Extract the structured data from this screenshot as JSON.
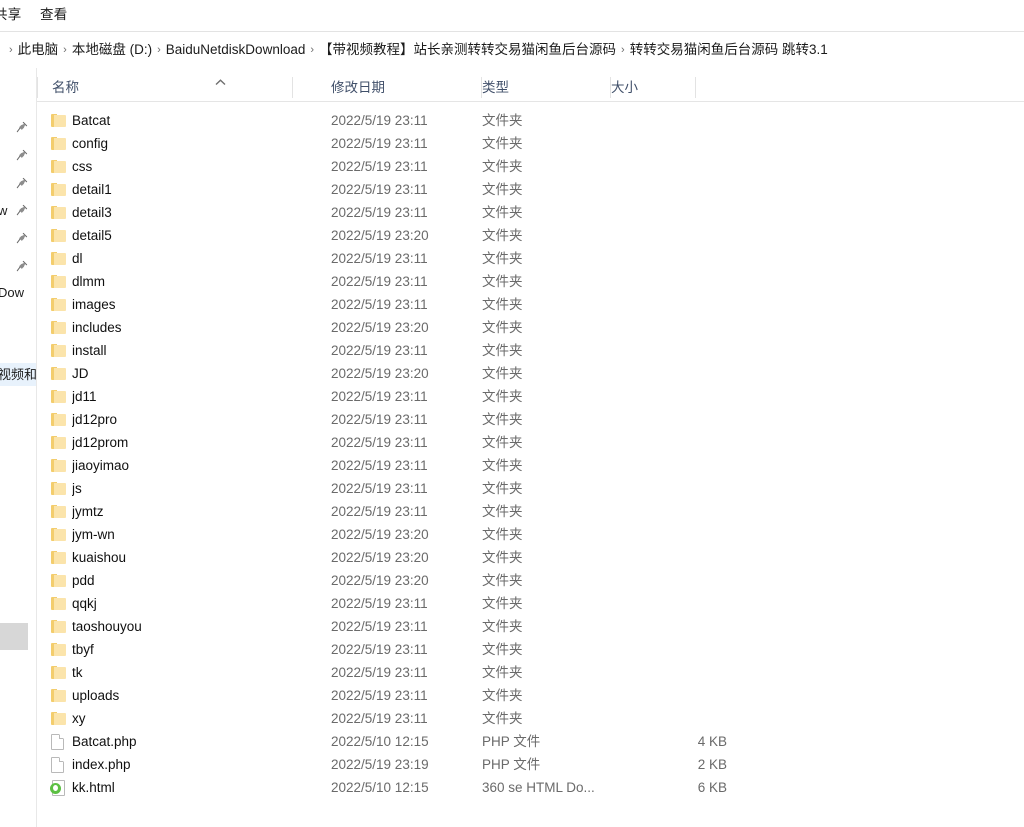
{
  "window": {
    "app": "windows-file-explorer"
  },
  "ribbon": {
    "tabs": [
      {
        "label": "共享",
        "name": "ribbon-tab-share"
      },
      {
        "label": "查看",
        "name": "ribbon-tab-view"
      }
    ]
  },
  "address_bar": {
    "separator": "›",
    "crumbs": [
      "此电脑",
      "本地磁盘 (D:)",
      "BaiduNetdiskDownload",
      "【带视频教程】站长亲测转转交易猫闲鱼后台源码",
      "转转交易猫闲鱼后台源码 跳转3.1"
    ]
  },
  "nav_pane": {
    "items": [
      {
        "label": "",
        "pinned": true,
        "highlight": false
      },
      {
        "label": "",
        "pinned": true,
        "highlight": false
      },
      {
        "label": "",
        "pinned": true,
        "highlight": false
      },
      {
        "label": "w",
        "pinned": true,
        "highlight": false
      },
      {
        "label": "",
        "pinned": true,
        "highlight": false
      },
      {
        "label": "",
        "pinned": true,
        "highlight": false
      },
      {
        "label": "Dow",
        "pinned": false,
        "highlight": false
      },
      {
        "label": "",
        "pinned": false,
        "highlight": false
      },
      {
        "label": "",
        "pinned": false,
        "highlight": false
      },
      {
        "label": "视频和",
        "pinned": false,
        "highlight": true
      }
    ]
  },
  "list_header": {
    "columns": [
      {
        "label": "名称",
        "key": "name"
      },
      {
        "label": "修改日期",
        "key": "date"
      },
      {
        "label": "类型",
        "key": "type"
      },
      {
        "label": "大小",
        "key": "size"
      }
    ],
    "sorted_by": "名称",
    "sort_direction": "ascending",
    "sort_icon": "chevron-up-icon"
  },
  "files": [
    {
      "name": "Batcat",
      "date": "2022/5/19 23:11",
      "type": "文件夹",
      "size": "",
      "icon": "folder"
    },
    {
      "name": "config",
      "date": "2022/5/19 23:11",
      "type": "文件夹",
      "size": "",
      "icon": "folder"
    },
    {
      "name": "css",
      "date": "2022/5/19 23:11",
      "type": "文件夹",
      "size": "",
      "icon": "folder"
    },
    {
      "name": "detail1",
      "date": "2022/5/19 23:11",
      "type": "文件夹",
      "size": "",
      "icon": "folder"
    },
    {
      "name": "detail3",
      "date": "2022/5/19 23:11",
      "type": "文件夹",
      "size": "",
      "icon": "folder"
    },
    {
      "name": "detail5",
      "date": "2022/5/19 23:20",
      "type": "文件夹",
      "size": "",
      "icon": "folder"
    },
    {
      "name": "dl",
      "date": "2022/5/19 23:11",
      "type": "文件夹",
      "size": "",
      "icon": "folder"
    },
    {
      "name": "dlmm",
      "date": "2022/5/19 23:11",
      "type": "文件夹",
      "size": "",
      "icon": "folder"
    },
    {
      "name": "images",
      "date": "2022/5/19 23:11",
      "type": "文件夹",
      "size": "",
      "icon": "folder"
    },
    {
      "name": "includes",
      "date": "2022/5/19 23:20",
      "type": "文件夹",
      "size": "",
      "icon": "folder"
    },
    {
      "name": "install",
      "date": "2022/5/19 23:11",
      "type": "文件夹",
      "size": "",
      "icon": "folder"
    },
    {
      "name": "JD",
      "date": "2022/5/19 23:20",
      "type": "文件夹",
      "size": "",
      "icon": "folder"
    },
    {
      "name": "jd11",
      "date": "2022/5/19 23:11",
      "type": "文件夹",
      "size": "",
      "icon": "folder"
    },
    {
      "name": "jd12pro",
      "date": "2022/5/19 23:11",
      "type": "文件夹",
      "size": "",
      "icon": "folder"
    },
    {
      "name": "jd12prom",
      "date": "2022/5/19 23:11",
      "type": "文件夹",
      "size": "",
      "icon": "folder"
    },
    {
      "name": "jiaoyimao",
      "date": "2022/5/19 23:11",
      "type": "文件夹",
      "size": "",
      "icon": "folder"
    },
    {
      "name": "js",
      "date": "2022/5/19 23:11",
      "type": "文件夹",
      "size": "",
      "icon": "folder"
    },
    {
      "name": "jymtz",
      "date": "2022/5/19 23:11",
      "type": "文件夹",
      "size": "",
      "icon": "folder"
    },
    {
      "name": "jym-wn",
      "date": "2022/5/19 23:20",
      "type": "文件夹",
      "size": "",
      "icon": "folder"
    },
    {
      "name": "kuaishou",
      "date": "2022/5/19 23:20",
      "type": "文件夹",
      "size": "",
      "icon": "folder"
    },
    {
      "name": "pdd",
      "date": "2022/5/19 23:20",
      "type": "文件夹",
      "size": "",
      "icon": "folder"
    },
    {
      "name": "qqkj",
      "date": "2022/5/19 23:11",
      "type": "文件夹",
      "size": "",
      "icon": "folder"
    },
    {
      "name": "taoshouyou",
      "date": "2022/5/19 23:11",
      "type": "文件夹",
      "size": "",
      "icon": "folder"
    },
    {
      "name": "tbyf",
      "date": "2022/5/19 23:11",
      "type": "文件夹",
      "size": "",
      "icon": "folder"
    },
    {
      "name": "tk",
      "date": "2022/5/19 23:11",
      "type": "文件夹",
      "size": "",
      "icon": "folder"
    },
    {
      "name": "uploads",
      "date": "2022/5/19 23:11",
      "type": "文件夹",
      "size": "",
      "icon": "folder"
    },
    {
      "name": "xy",
      "date": "2022/5/19 23:11",
      "type": "文件夹",
      "size": "",
      "icon": "folder"
    },
    {
      "name": "Batcat.php",
      "date": "2022/5/10 12:15",
      "type": "PHP 文件",
      "size": "4 KB",
      "icon": "document"
    },
    {
      "name": "index.php",
      "date": "2022/5/19 23:19",
      "type": "PHP 文件",
      "size": "2 KB",
      "icon": "document"
    },
    {
      "name": "kk.html",
      "date": "2022/5/10 12:15",
      "type": "360 se HTML Do...",
      "size": "6 KB",
      "icon": "html-360"
    }
  ],
  "colors": {
    "folder_front": "#fbe4ab",
    "folder_back": "#f3cd6d",
    "header_text": "#41506a",
    "secondary_text": "#6a6a6a",
    "highlight": "#e8f2fc",
    "badge_green": "#5cc043"
  }
}
